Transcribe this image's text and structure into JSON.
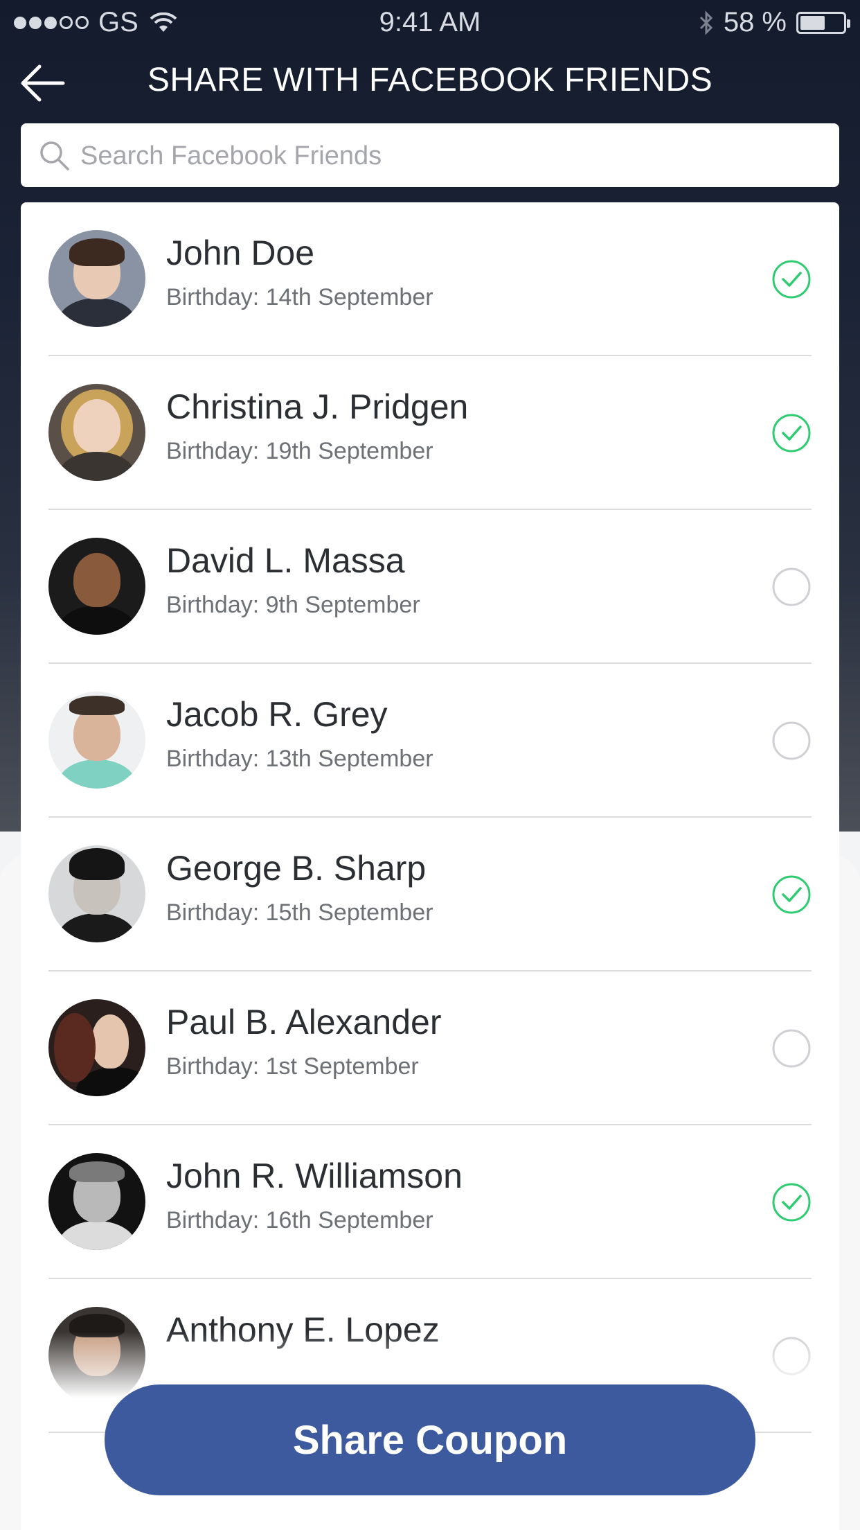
{
  "status_bar": {
    "carrier": "GS",
    "time": "9:41 AM",
    "battery": "58 %",
    "battery_level": 0.58
  },
  "header": {
    "title": "SHARE WITH FACEBOOK FRIENDS",
    "back_icon": "arrow-left-icon"
  },
  "search": {
    "placeholder": "Search Facebook Friends",
    "icon": "search-icon"
  },
  "friends": [
    {
      "name": "John Doe",
      "birthday": "Birthday: 14th September",
      "selected": true
    },
    {
      "name": "Christina J. Pridgen",
      "birthday": "Birthday: 19th September",
      "selected": true
    },
    {
      "name": "David L. Massa",
      "birthday": "Birthday: 9th September",
      "selected": false
    },
    {
      "name": "Jacob R. Grey",
      "birthday": "Birthday: 13th September",
      "selected": false
    },
    {
      "name": "George B. Sharp",
      "birthday": "Birthday: 15th September",
      "selected": true
    },
    {
      "name": "Paul B. Alexander",
      "birthday": "Birthday: 1st September",
      "selected": false
    },
    {
      "name": "John R. Williamson",
      "birthday": "Birthday: 16th September",
      "selected": true
    },
    {
      "name": "Anthony E. Lopez",
      "birthday": "",
      "selected": false
    }
  ],
  "share_button": {
    "label": "Share Coupon"
  },
  "colors": {
    "accent": "#3d5a9f",
    "check_green": "#2ecc71",
    "header_bg": "#141b2c"
  }
}
